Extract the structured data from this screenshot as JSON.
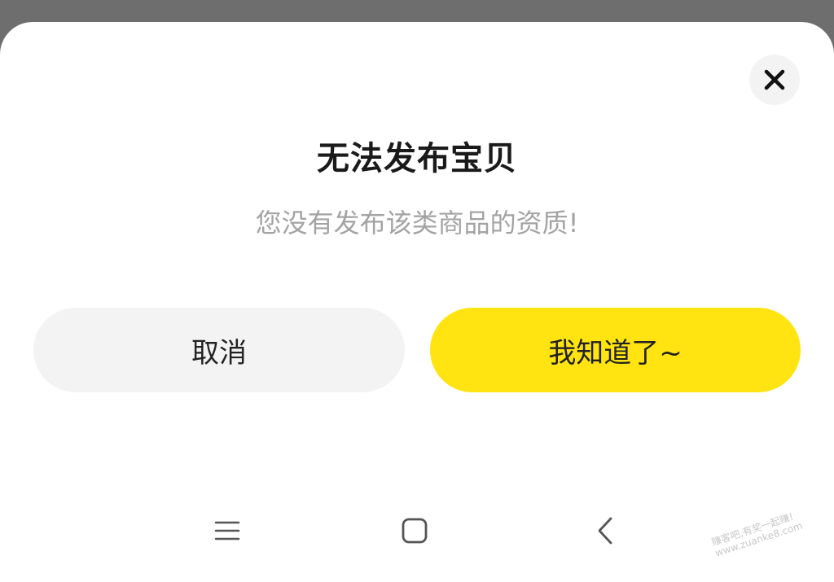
{
  "dialog": {
    "title": "无法发布宝贝",
    "message": "您没有发布该类商品的资质!",
    "cancel_label": "取消",
    "confirm_label": "我知道了~",
    "close_icon": "close-icon"
  },
  "colors": {
    "confirm_button": "#ffe411",
    "cancel_button": "#f3f3f3",
    "title_text": "#1a1a1a",
    "message_text": "#a3a3a3",
    "backdrop": "#6e6e6e"
  },
  "navbar": {
    "icons": [
      "menu-icon",
      "home-icon",
      "back-icon"
    ]
  },
  "watermark": {
    "line1": "赚客吧,有奖一起赚!",
    "line2": "www.zuanke8.com"
  }
}
